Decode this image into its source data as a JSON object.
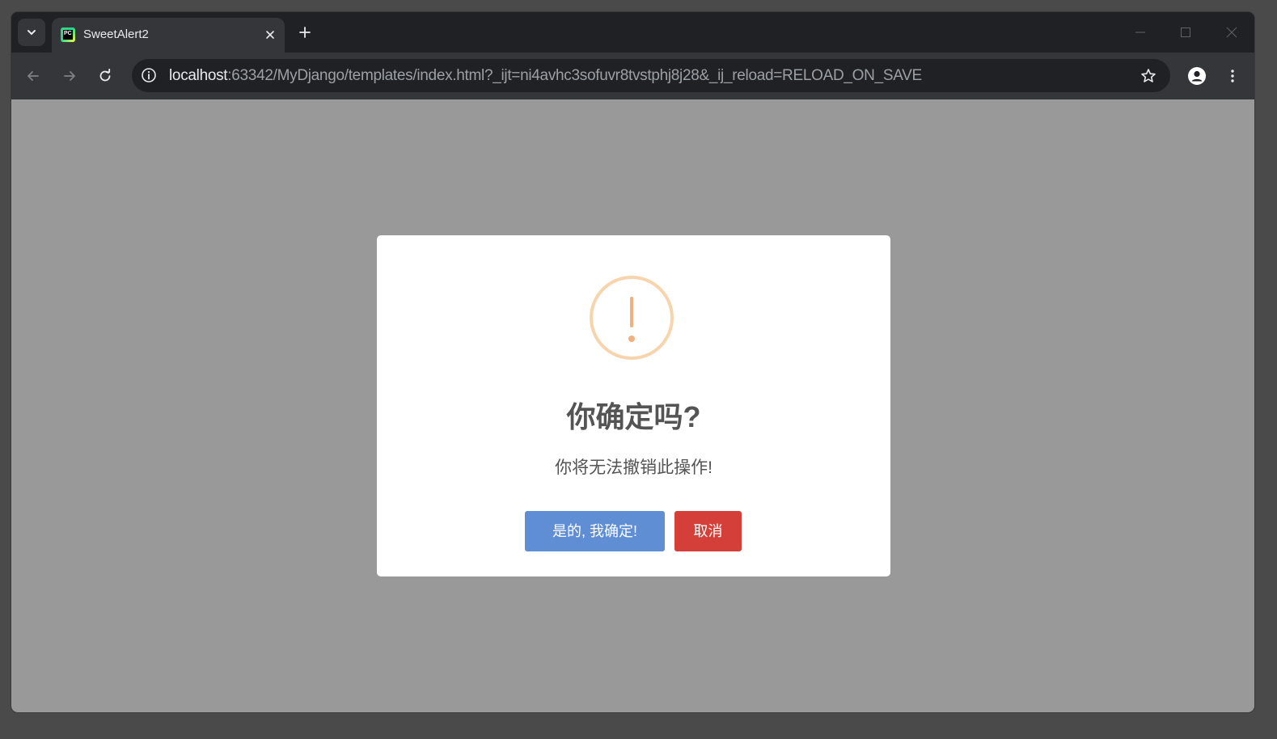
{
  "browser": {
    "tab": {
      "title": "SweetAlert2",
      "favicon_text": "PC"
    },
    "address": {
      "host": "localhost",
      "rest": ":63342/MyDjango/templates/index.html?_ijt=ni4avhc3sofuvr8tvstphj8j28&_ij_reload=RELOAD_ON_SAVE"
    },
    "icons": {
      "tab_search": "chevron-down-icon",
      "tab_close": "close-icon",
      "new_tab": "plus-icon",
      "back": "arrow-left-icon",
      "forward": "arrow-right-icon",
      "reload": "reload-icon",
      "site_info": "info-icon",
      "bookmark": "star-icon",
      "profile": "person-icon",
      "menu": "more-vert-icon"
    }
  },
  "dialog": {
    "icon": "warning-icon",
    "title": "你确定吗?",
    "text": "你将无法撤销此操作!",
    "confirm_label": "是的, 我确定!",
    "cancel_label": "取消"
  },
  "colors": {
    "confirm": "#5f8ed5",
    "cancel": "#d43f3a",
    "warning": "#f8bb86",
    "backdrop": "#999999"
  }
}
